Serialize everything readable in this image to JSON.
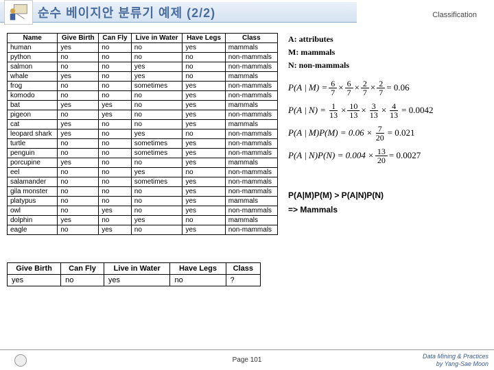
{
  "header": {
    "title": "순수 베이지안 분류기 예제 (2/2)",
    "classification": "Classification"
  },
  "table": {
    "headers": [
      "Name",
      "Give Birth",
      "Can Fly",
      "Live in Water",
      "Have Legs",
      "Class"
    ],
    "rows": [
      [
        "human",
        "yes",
        "no",
        "no",
        "yes",
        "mammals"
      ],
      [
        "python",
        "no",
        "no",
        "no",
        "no",
        "non-mammals"
      ],
      [
        "salmon",
        "no",
        "no",
        "yes",
        "no",
        "non-mammals"
      ],
      [
        "whale",
        "yes",
        "no",
        "yes",
        "no",
        "mammals"
      ],
      [
        "frog",
        "no",
        "no",
        "sometimes",
        "yes",
        "non-mammals"
      ],
      [
        "komodo",
        "no",
        "no",
        "no",
        "yes",
        "non-mammals"
      ],
      [
        "bat",
        "yes",
        "yes",
        "no",
        "yes",
        "mammals"
      ],
      [
        "pigeon",
        "no",
        "yes",
        "no",
        "yes",
        "non-mammals"
      ],
      [
        "cat",
        "yes",
        "no",
        "no",
        "yes",
        "mammals"
      ],
      [
        "leopard shark",
        "yes",
        "no",
        "yes",
        "no",
        "non-mammals"
      ],
      [
        "turtle",
        "no",
        "no",
        "sometimes",
        "yes",
        "non-mammals"
      ],
      [
        "penguin",
        "no",
        "no",
        "sometimes",
        "yes",
        "non-mammals"
      ],
      [
        "porcupine",
        "yes",
        "no",
        "no",
        "yes",
        "mammals"
      ],
      [
        "eel",
        "no",
        "no",
        "yes",
        "no",
        "non-mammals"
      ],
      [
        "salamander",
        "no",
        "no",
        "sometimes",
        "yes",
        "non-mammals"
      ],
      [
        "gila monster",
        "no",
        "no",
        "no",
        "yes",
        "non-mammals"
      ],
      [
        "platypus",
        "no",
        "no",
        "no",
        "yes",
        "mammals"
      ],
      [
        "owl",
        "no",
        "yes",
        "no",
        "yes",
        "non-mammals"
      ],
      [
        "dolphin",
        "yes",
        "no",
        "yes",
        "no",
        "mammals"
      ],
      [
        "eagle",
        "no",
        "yes",
        "no",
        "yes",
        "non-mammals"
      ]
    ]
  },
  "test_table": {
    "headers": [
      "Give Birth",
      "Can Fly",
      "Live in Water",
      "Have Legs",
      "Class"
    ],
    "row": [
      "yes",
      "no",
      "yes",
      "no",
      "?"
    ]
  },
  "definitions": {
    "a": "A: attributes",
    "m": "M: mammals",
    "n": "N: non-mammals"
  },
  "equations": {
    "eq1": {
      "lhs": "P(A | M) =",
      "f1n": "6",
      "f1d": "7",
      "f2n": "6",
      "f2d": "7",
      "f3n": "2",
      "f3d": "7",
      "f4n": "2",
      "f4d": "7",
      "rhs": "= 0.06"
    },
    "eq2": {
      "lhs": "P(A | N) =",
      "f1n": "1",
      "f1d": "13",
      "f2n": "10",
      "f2d": "13",
      "f3n": "3",
      "f3d": "13",
      "f4n": "4",
      "f4d": "13",
      "rhs": "= 0.0042"
    },
    "eq3": {
      "lhs": "P(A | M)P(M) = 0.06 ×",
      "fn": "7",
      "fd": "20",
      "rhs": "= 0.021"
    },
    "eq4": {
      "lhs": "P(A | N)P(N) = 0.004 ×",
      "fn": "13",
      "fd": "20",
      "rhs": "= 0.0027"
    }
  },
  "result": {
    "line1": "P(A|M)P(M) > P(A|N)P(N)",
    "line2": "=> Mammals"
  },
  "footer": {
    "page": "Page 101",
    "credit1": "Data Mining & Practices",
    "credit2": "by Yang-Sae Moon"
  }
}
